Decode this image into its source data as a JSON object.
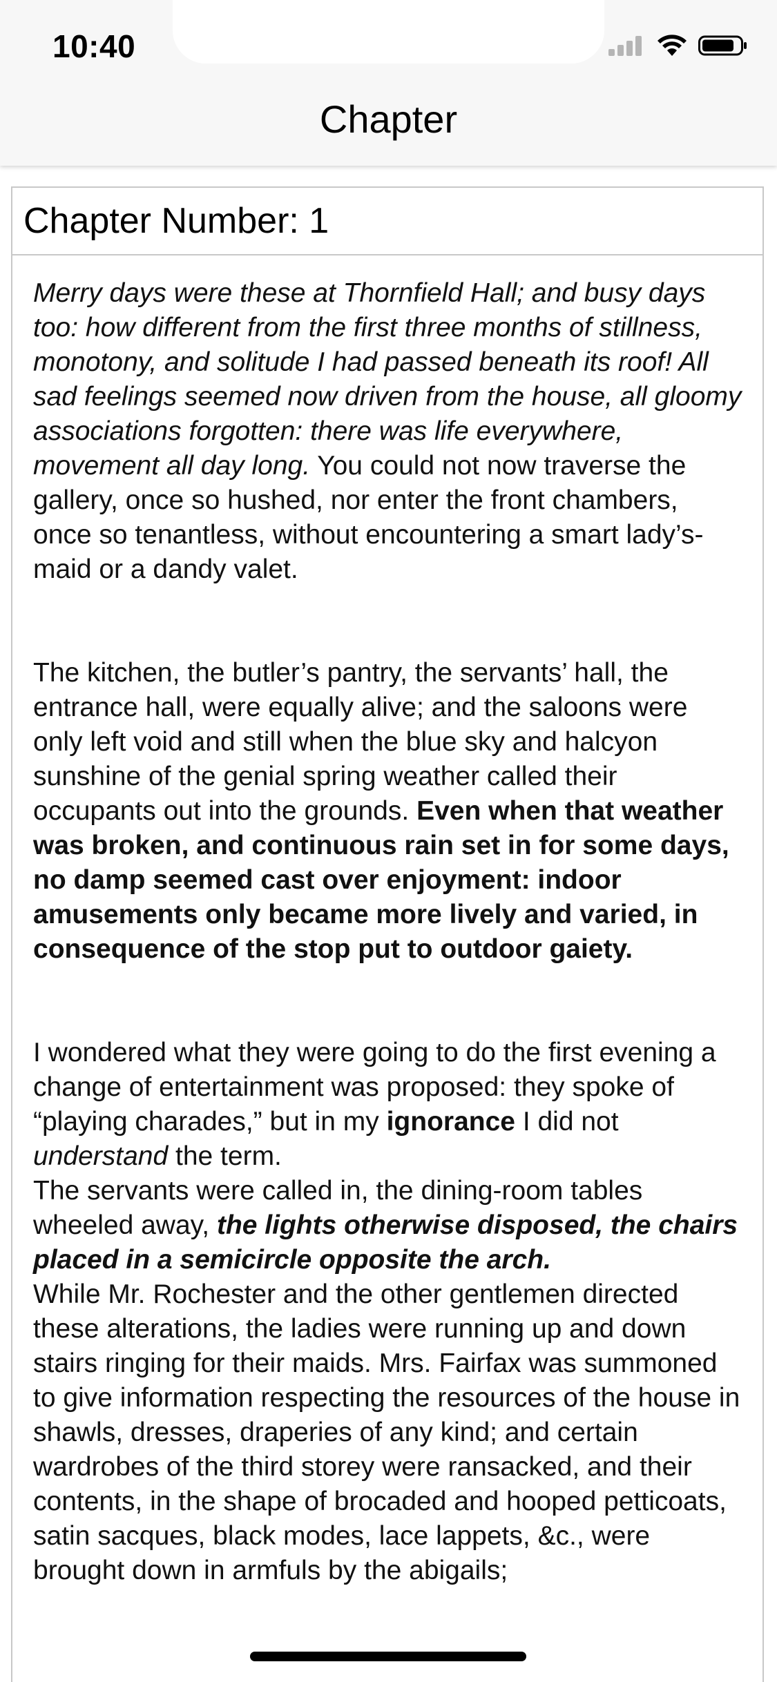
{
  "status_bar": {
    "time": "10:40",
    "icons": [
      "cellular-signal-icon",
      "wifi-icon",
      "battery-icon"
    ]
  },
  "nav": {
    "title": "Chapter"
  },
  "chapter": {
    "label": "Chapter Number: 1",
    "p1": {
      "italic": "Merry days were these at Thornfield Hall; and busy days too: how different from the first three months of stillness, monotony, and solitude I had passed beneath its roof! All sad feelings seemed now driven from the house, all gloomy associations forgotten: there was life everywhere, movement all day long.",
      "normal": "You could not now traverse the gallery, once so hushed, nor enter the front chambers, once so tenantless, without encountering a smart lady’s-maid or a dandy valet."
    },
    "p2": {
      "normal": "The kitchen, the butler’s pantry, the servants’ hall, the entrance hall, were equally alive; and the saloons were only left void and still when the blue sky and halcyon sunshine of the genial spring weather called their occupants out into the grounds.",
      "bold": "Even when that weather was broken, and continuous rain set in for some days, no damp seemed cast over enjoyment: indoor amusements only became more lively and varied, in consequence of the stop put to outdoor gaiety."
    },
    "p3": {
      "s1": "I wondered what they were going to do the first evening a change of entertainment was proposed: they spoke of “playing charades,” but in my",
      "s1_bold": "ignorance",
      "s2": "I did not",
      "s2_italic": "understand",
      "s3": "the term.",
      "s4": "The servants were called in, the dining-room tables wheeled away,",
      "s4_bold_italic": "the lights otherwise disposed, the chairs placed in a semicircle opposite the arch.",
      "s5": "While Mr. Rochester and the other gentlemen directed these alterations, the ladies were running up and down stairs ringing for their maids. Mrs. Fairfax was summoned to give information respecting the resources of the house in shawls, dresses, draperies of any kind; and certain wardrobes of the third storey were ransacked, and their contents, in the shape of brocaded and hooped petticoats, satin sacques, black modes, lace lappets, &c., were brought down in armfuls by the abigails;"
    }
  }
}
